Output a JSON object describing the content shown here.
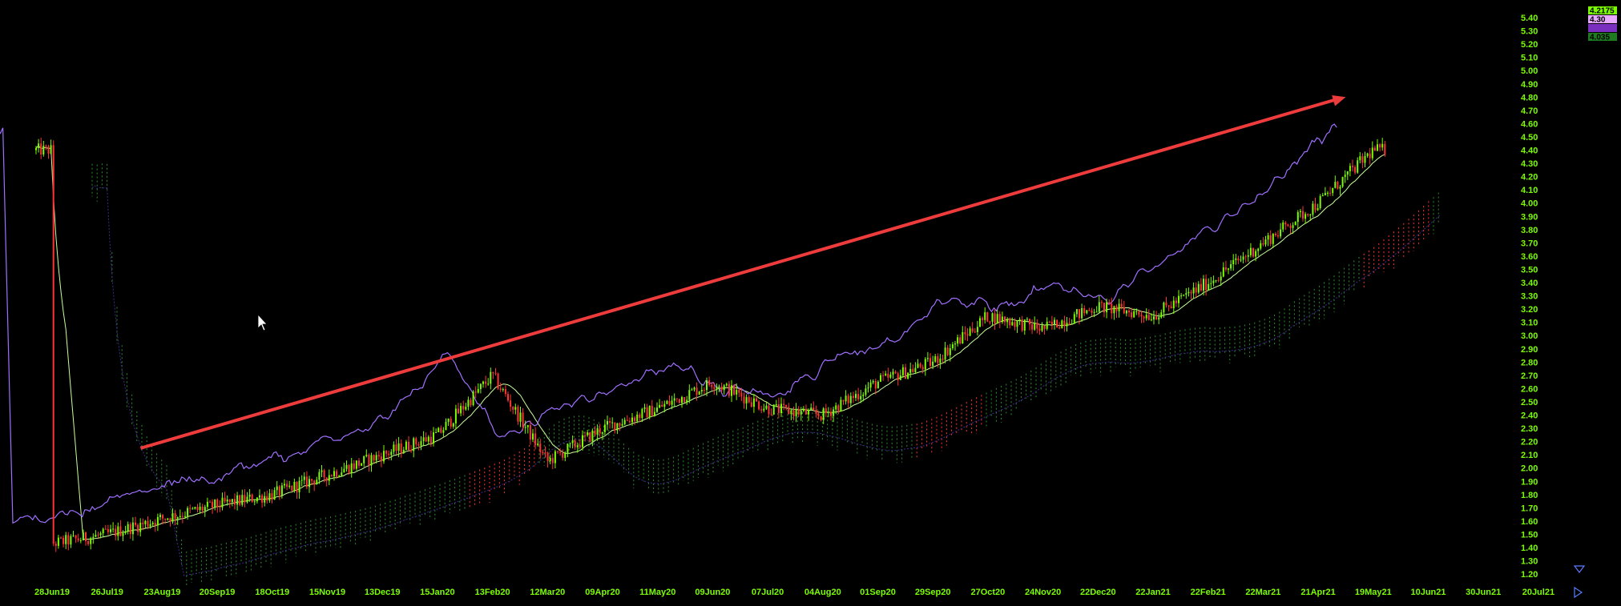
{
  "chart_data": {
    "type": "candlestick",
    "title": "",
    "xlabel": "",
    "ylabel": "",
    "ylim": [
      1.15,
      5.5
    ],
    "yticks": [
      "5.40",
      "5.30",
      "5.20",
      "5.10",
      "5.00",
      "4.90",
      "4.80",
      "4.70",
      "4.60",
      "4.50",
      "4.40",
      "4.30",
      "4.20",
      "4.10",
      "4.00",
      "3.90",
      "3.80",
      "3.70",
      "3.60",
      "3.50",
      "3.40",
      "3.30",
      "3.20",
      "3.10",
      "3.00",
      "2.90",
      "2.80",
      "2.70",
      "2.60",
      "2.50",
      "2.40",
      "2.30",
      "2.20",
      "2.10",
      "2.00",
      "1.90",
      "1.80",
      "1.70",
      "1.60",
      "1.50",
      "1.40",
      "1.30",
      "1.20"
    ],
    "xticks": [
      "28Jun19",
      "26Jul19",
      "23Aug19",
      "20Sep19",
      "18Oct19",
      "15Nov19",
      "13Dec19",
      "15Jan20",
      "13Feb20",
      "12Mar20",
      "09Apr20",
      "11May20",
      "09Jun20",
      "07Jul20",
      "04Aug20",
      "01Sep20",
      "29Sep20",
      "27Oct20",
      "24Nov20",
      "22Dec20",
      "22Jan21",
      "22Feb21",
      "22Mar21",
      "21Apr21",
      "19May21",
      "10Jun21",
      "30Jun21",
      "20Jul21"
    ],
    "price_path": [
      [
        "28Jun19",
        1.43
      ],
      [
        "26Jul19",
        1.5
      ],
      [
        "23Aug19",
        1.62
      ],
      [
        "20Sep19",
        1.72
      ],
      [
        "18Oct19",
        1.8
      ],
      [
        "15Nov19",
        1.95
      ],
      [
        "13Dec19",
        2.1
      ],
      [
        "15Jan20",
        2.25
      ],
      [
        "13Feb20",
        2.7
      ],
      [
        "12Mar20",
        2.05
      ],
      [
        "09Apr20",
        2.3
      ],
      [
        "11May20",
        2.45
      ],
      [
        "09Jun20",
        2.65
      ],
      [
        "07Jul20",
        2.45
      ],
      [
        "04Aug20",
        2.4
      ],
      [
        "01Sep20",
        2.65
      ],
      [
        "29Sep20",
        2.8
      ],
      [
        "27Oct20",
        3.15
      ],
      [
        "24Nov20",
        3.05
      ],
      [
        "22Dec20",
        3.22
      ],
      [
        "22Jan21",
        3.15
      ],
      [
        "22Feb21",
        3.4
      ],
      [
        "22Mar21",
        3.7
      ],
      [
        "21Apr21",
        4.0
      ],
      [
        "19May21",
        4.4
      ]
    ],
    "series": [
      {
        "name": "",
        "color": "#7CFC00"
      },
      {
        "name": "",
        "color": "#FF3333"
      }
    ],
    "price_badges": [
      {
        "text": "4.2175",
        "color": "#7CFC00"
      },
      {
        "text": "4.30",
        "color": "#E8A8FF"
      },
      {
        "text": "",
        "color": "#7B2FBF"
      },
      {
        "text": "4.035",
        "color": "#1E7A1E"
      }
    ],
    "arrow": {
      "from": [
        "12Aug19",
        2.15
      ],
      "to": [
        "05May21",
        4.8
      ],
      "color": "#EE3B3B"
    },
    "grid": false,
    "legend": "none"
  }
}
